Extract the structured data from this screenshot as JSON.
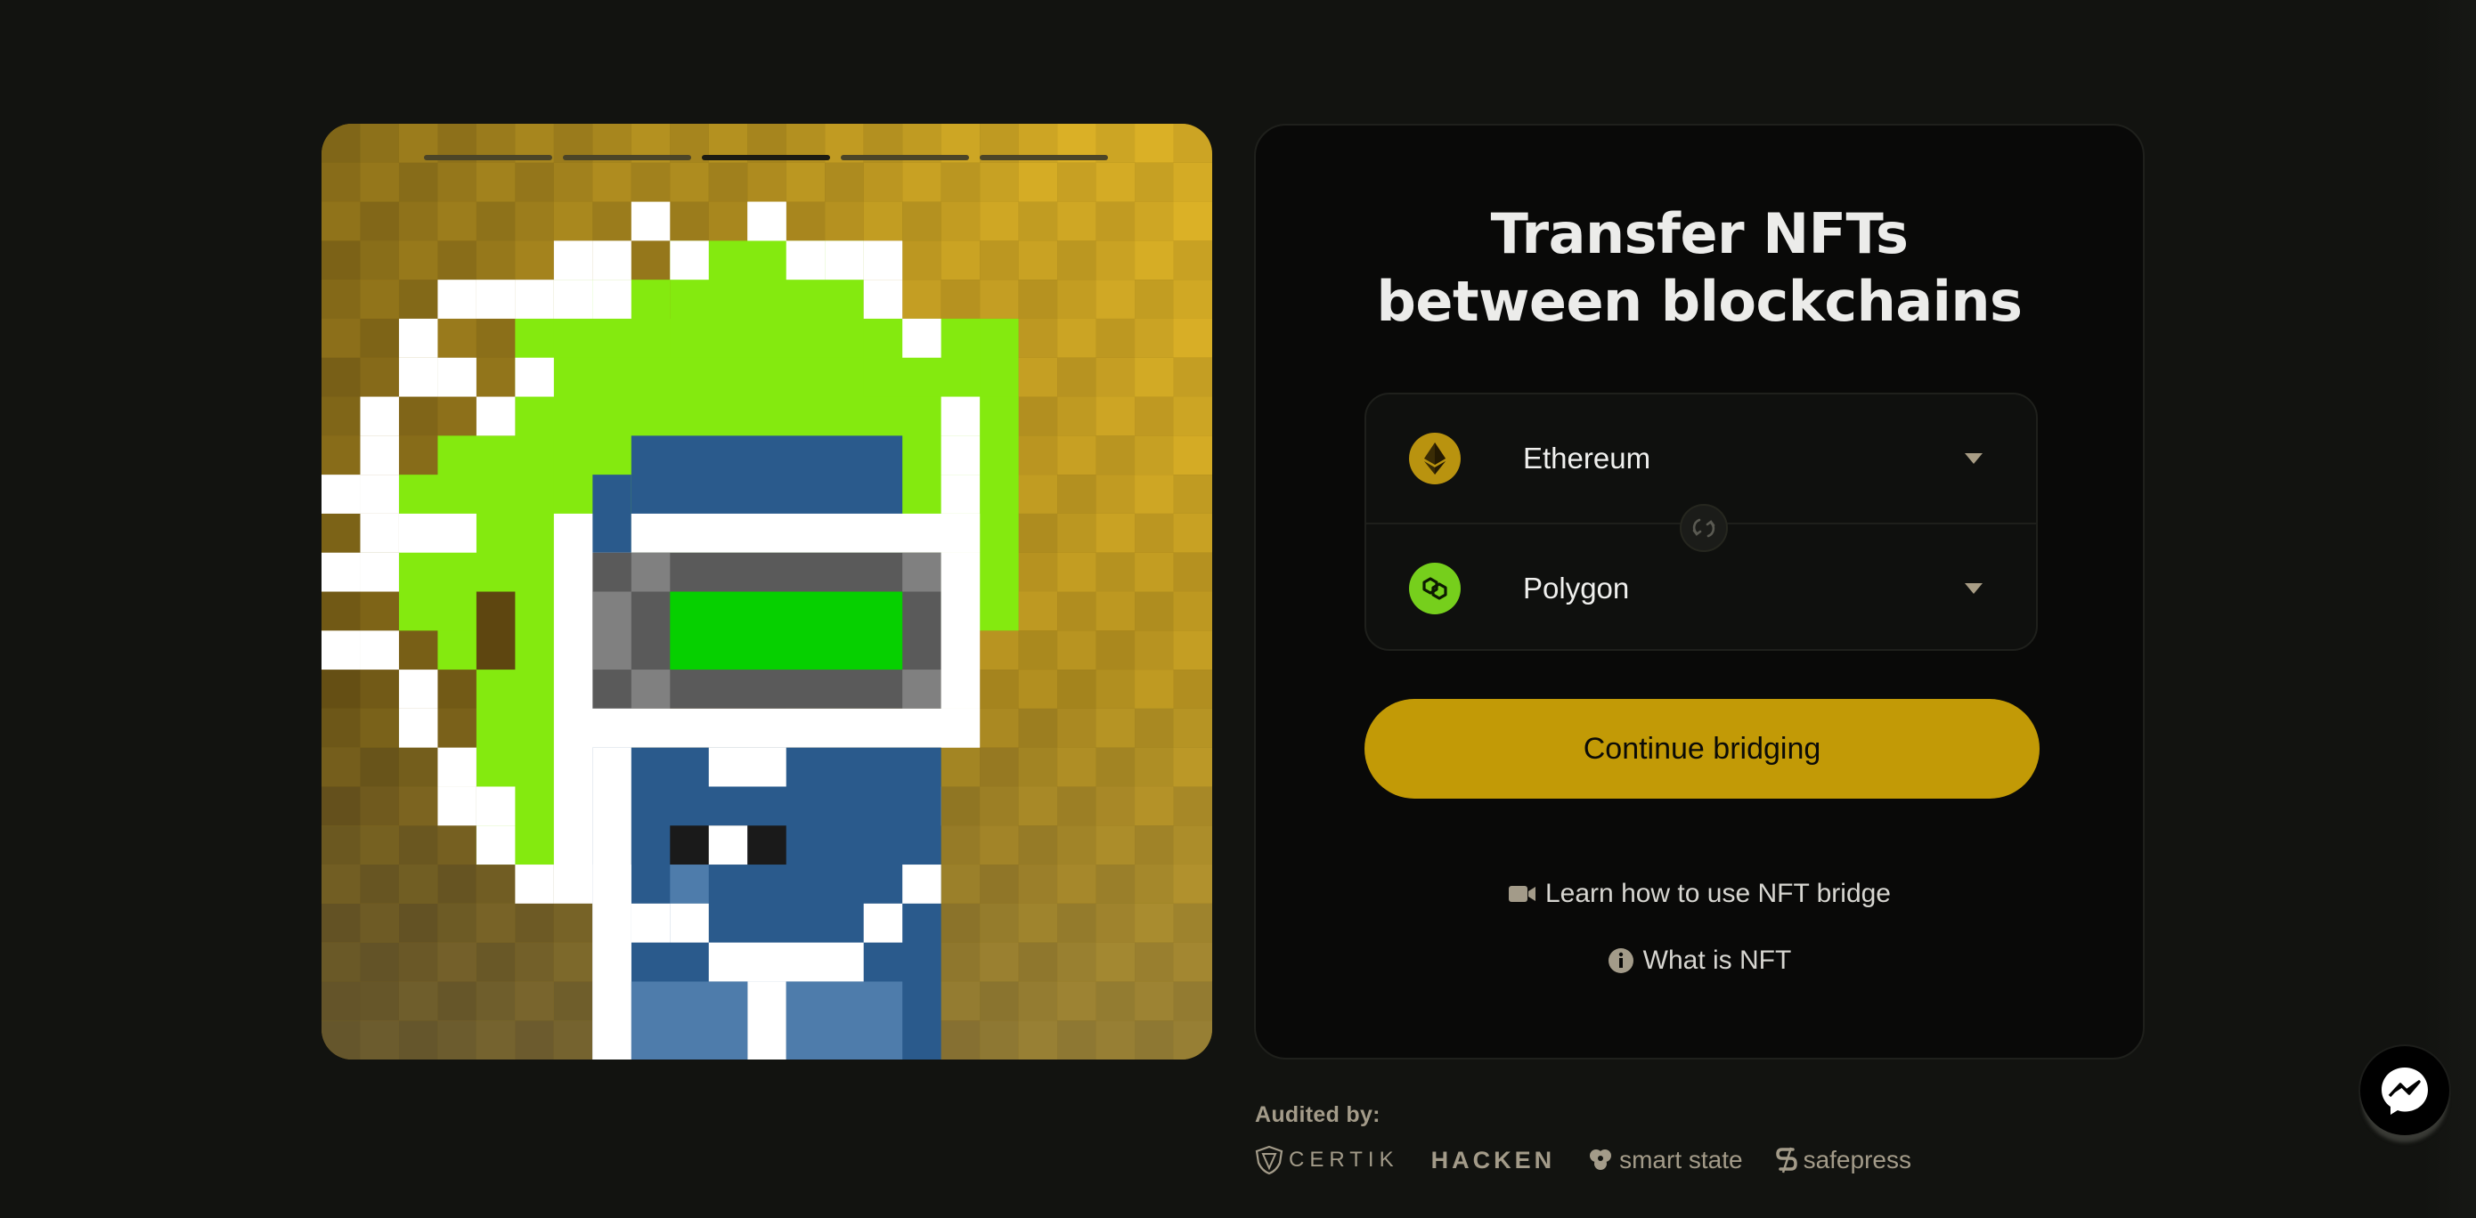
{
  "hero": {
    "title_line1": "Transfer NFTs",
    "title_line2": "between blockchains"
  },
  "slideshow": {
    "slides": 5,
    "active_index": 2
  },
  "bridge": {
    "from_chain": {
      "name": "Ethereum",
      "icon": "ethereum-icon",
      "color": "#c29a06"
    },
    "to_chain": {
      "name": "Polygon",
      "icon": "polygon-icon",
      "color": "#7ed321"
    },
    "continue_label": "Continue bridging",
    "learn_link": "Learn how to use NFT bridge",
    "what_is_link": "What is NFT"
  },
  "audits": {
    "label": "Audited by:",
    "auditors": [
      "CERTIK",
      "HACKEN",
      "smart state",
      "safepress"
    ]
  },
  "colors": {
    "background": "#121310",
    "accent": "#c29a06",
    "panel": "#090908"
  }
}
